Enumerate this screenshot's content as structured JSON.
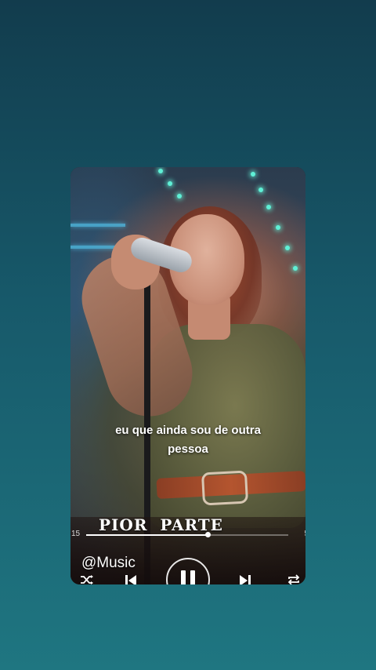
{
  "video": {
    "lyric_lines": [
      "eu que ainda sou de outra",
      "pessoa"
    ]
  },
  "player": {
    "song_title": "PIOR  PARTE",
    "time_elapsed": "15",
    "time_total": "5",
    "progress_fraction": 0.6,
    "channel_handle": "@Music",
    "state": "playing"
  },
  "controls": {
    "shuffle_icon": "shuffle-icon",
    "previous_icon": "skip-previous-icon",
    "pause_icon": "pause-icon",
    "next_icon": "skip-next-icon",
    "repeat_icon": "repeat-icon"
  },
  "colors": {
    "background_top": "#123c4d",
    "background_bottom": "#1f7681",
    "led_accent": "#5ff0d6"
  }
}
